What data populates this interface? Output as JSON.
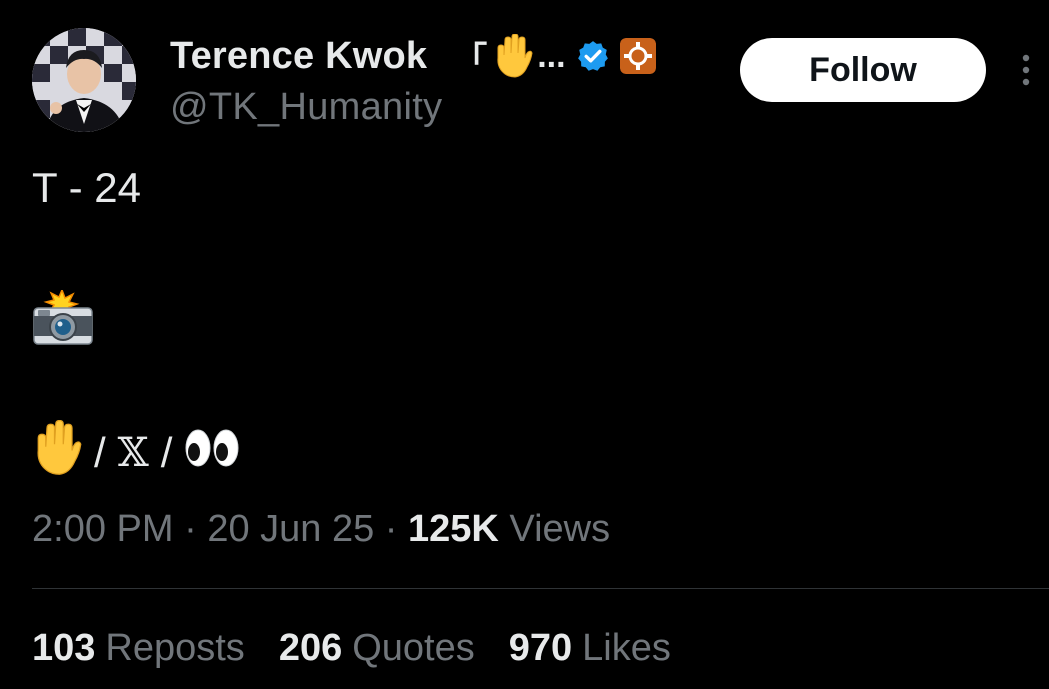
{
  "author": {
    "display_name": "Terence Kwok",
    "name_suffix": "「",
    "name_suffix_emoji": "raised-hand-emoji",
    "truncation": "...",
    "handle": "@TK_Humanity",
    "verified_icon": "verified-badge-icon",
    "affiliate_icon": "affiliate-badge-icon"
  },
  "follow_label": "Follow",
  "more_icon": "more-options-icon",
  "tweet": {
    "line1": "T - 24",
    "line2_emoji": "camera-with-flash-emoji",
    "line3": {
      "emoji_left": "raised-hand-emoji",
      "sep1": "/",
      "x_char": "𝕏",
      "sep2": "/",
      "emoji_right": "eyes-emoji"
    }
  },
  "meta": {
    "time": "2:00 PM",
    "dot1": "·",
    "date": "20 Jun 25",
    "dot2": "·",
    "views_count": "125K",
    "views_label": "Views"
  },
  "stats": {
    "reposts_count": "103",
    "reposts_label": "Reposts",
    "quotes_count": "206",
    "quotes_label": "Quotes",
    "likes_count": "970",
    "likes_label": "Likes"
  },
  "colors": {
    "background": "#000000",
    "text_primary": "#e7e9ea",
    "text_secondary": "#71767b",
    "verified_blue": "#1d9bf0",
    "affiliate_orange": "#c8611a",
    "divider": "#2f3336"
  }
}
